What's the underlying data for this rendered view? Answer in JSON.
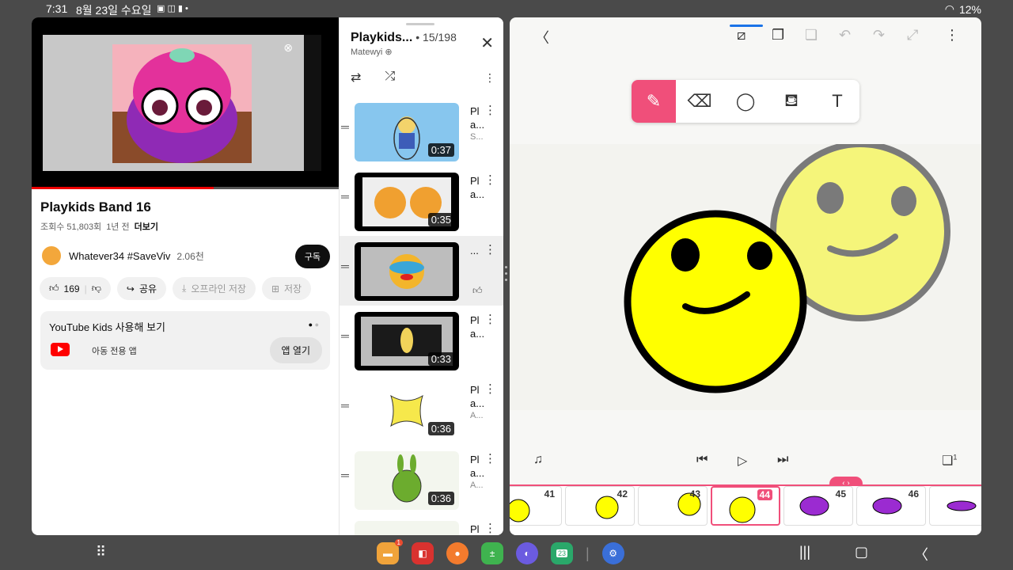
{
  "status": {
    "time": "7:31",
    "date": "8월 23일 수요일",
    "battery": "12%"
  },
  "youtube": {
    "title": "Playkids Band 16",
    "views": "조회수 51,803회",
    "age": "1년 전",
    "more": "더보기",
    "channel": "Whatever34 #SaveViv",
    "subscribers": "2.06천",
    "subscribe": "구독",
    "likes": "169",
    "share": "공유",
    "offline": "오프라인 저장",
    "save": "저장",
    "kids_title": "YouTube Kids 사용해 보기",
    "kids_sub": "아동 전용 앱",
    "kids_open": "앱 열기"
  },
  "playlist": {
    "title": "Playkids...",
    "position": "• 15/198",
    "owner": "Matewyi",
    "items": [
      {
        "duration": "0:37",
        "title": "Pl a...",
        "sub": "S..."
      },
      {
        "duration": "0:35",
        "title": "Pl a...",
        "sub": ""
      },
      {
        "duration": "",
        "title": "...",
        "sub": ""
      },
      {
        "duration": "0:33",
        "title": "Pl a...",
        "sub": ""
      },
      {
        "duration": "0:36",
        "title": "Pl a...",
        "sub": "A..."
      },
      {
        "duration": "0:36",
        "title": "Pl a...",
        "sub": "A..."
      },
      {
        "duration": "",
        "title": "Pl",
        "sub": ""
      }
    ]
  },
  "flipaclip": {
    "frames": [
      "41",
      "42",
      "43",
      "44",
      "45",
      "46"
    ],
    "selected_frame": "44",
    "layers_badge": "1"
  },
  "taskbar": {
    "badge": "1",
    "calendar": "23"
  },
  "colors": {
    "accent": "#f04f7a",
    "yt_red": "#ff0000"
  }
}
